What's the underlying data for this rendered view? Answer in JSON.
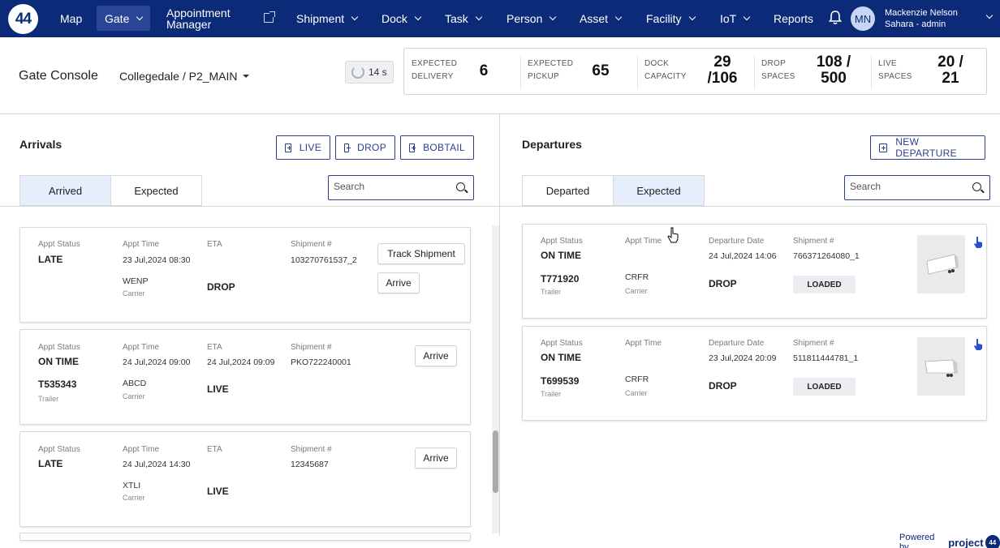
{
  "nav": {
    "logo": "44",
    "items": [
      "Map",
      "Gate",
      "Appointment Manager",
      "Shipment",
      "Dock",
      "Task",
      "Person",
      "Asset",
      "Facility",
      "IoT",
      "Reports"
    ],
    "user_initials": "MN",
    "user_name": "Mackenzie Nelson",
    "user_role": "Sahara - admin"
  },
  "header": {
    "title": "Gate Console",
    "location": "Collegedale / P2_MAIN",
    "refresh": "14 s",
    "stats": [
      {
        "label1": "EXPECTED",
        "label2": "DELIVERY",
        "value1": "6",
        "value2": ""
      },
      {
        "label1": "EXPECTED",
        "label2": "PICKUP",
        "value1": "65",
        "value2": ""
      },
      {
        "label1": "DOCK",
        "label2": "CAPACITY",
        "value1": "29",
        "value2": "/106"
      },
      {
        "label1": "DROP",
        "label2": "SPACES",
        "value1": "108 /",
        "value2": "500"
      },
      {
        "label1": "LIVE",
        "label2": "SPACES",
        "value1": "20 /",
        "value2": "21"
      }
    ]
  },
  "arrivals": {
    "title": "Arrivals",
    "buttons": [
      "LIVE",
      "DROP",
      "BOBTAIL"
    ],
    "tabs": [
      "Arrived",
      "Expected"
    ],
    "search_placeholder": "Search",
    "labels": {
      "status": "Appt Status",
      "time": "Appt Time",
      "eta": "ETA",
      "shipment": "Shipment #",
      "carrier": "Carrier",
      "trailer": "Trailer"
    },
    "cards": [
      {
        "status": "LATE",
        "time": "23 Jul,2024 08:30",
        "eta": "",
        "shipment": "103270761537_2",
        "trailer": "",
        "carrier": "WENP",
        "type": "DROP",
        "track": "Track Shipment",
        "arrive": "Arrive"
      },
      {
        "status": "ON TIME",
        "time": "24 Jul,2024 09:00",
        "eta": "24 Jul,2024 09:09",
        "shipment": "PKO722240001",
        "trailer": "T535343",
        "carrier": "ABCD",
        "type": "LIVE",
        "track": "",
        "arrive": "Arrive"
      },
      {
        "status": "LATE",
        "time": "24 Jul,2024 14:30",
        "eta": "",
        "shipment": "12345687",
        "trailer": "",
        "carrier": "XTLI",
        "type": "LIVE",
        "track": "",
        "arrive": "Arrive"
      }
    ]
  },
  "departures": {
    "title": "Departures",
    "button": "NEW DEPARTURE",
    "tabs": [
      "Departed",
      "Expected"
    ],
    "search_placeholder": "Search",
    "labels": {
      "status": "Appt Status",
      "time": "Appt Time",
      "date": "Departure Date",
      "shipment": "Shipment #",
      "carrier": "Carrier",
      "trailer": "Trailer"
    },
    "cards": [
      {
        "status": "ON TIME",
        "time": "",
        "date": "24 Jul,2024 14:06",
        "shipment": "766371264080_1",
        "trailer": "T771920",
        "carrier": "CRFR",
        "type": "DROP",
        "badge": "LOADED"
      },
      {
        "status": "ON TIME",
        "time": "",
        "date": "23 Jul,2024 20:09",
        "shipment": "511811444781_1",
        "trailer": "T699539",
        "carrier": "CRFR",
        "type": "DROP",
        "badge": "LOADED"
      }
    ]
  },
  "footer": {
    "powered_by": "Powered by",
    "brand": "project",
    "brand_logo": "44"
  },
  "colors": {
    "nav_bg": "#0b2a78",
    "accent": "#2c3f8f",
    "tab_selected": "#e6eefb"
  },
  "icons": [
    "external-link-icon",
    "bell-icon",
    "refresh-icon",
    "plus-icon",
    "search-icon",
    "trailer-icon",
    "hand-pointer-icon"
  ]
}
